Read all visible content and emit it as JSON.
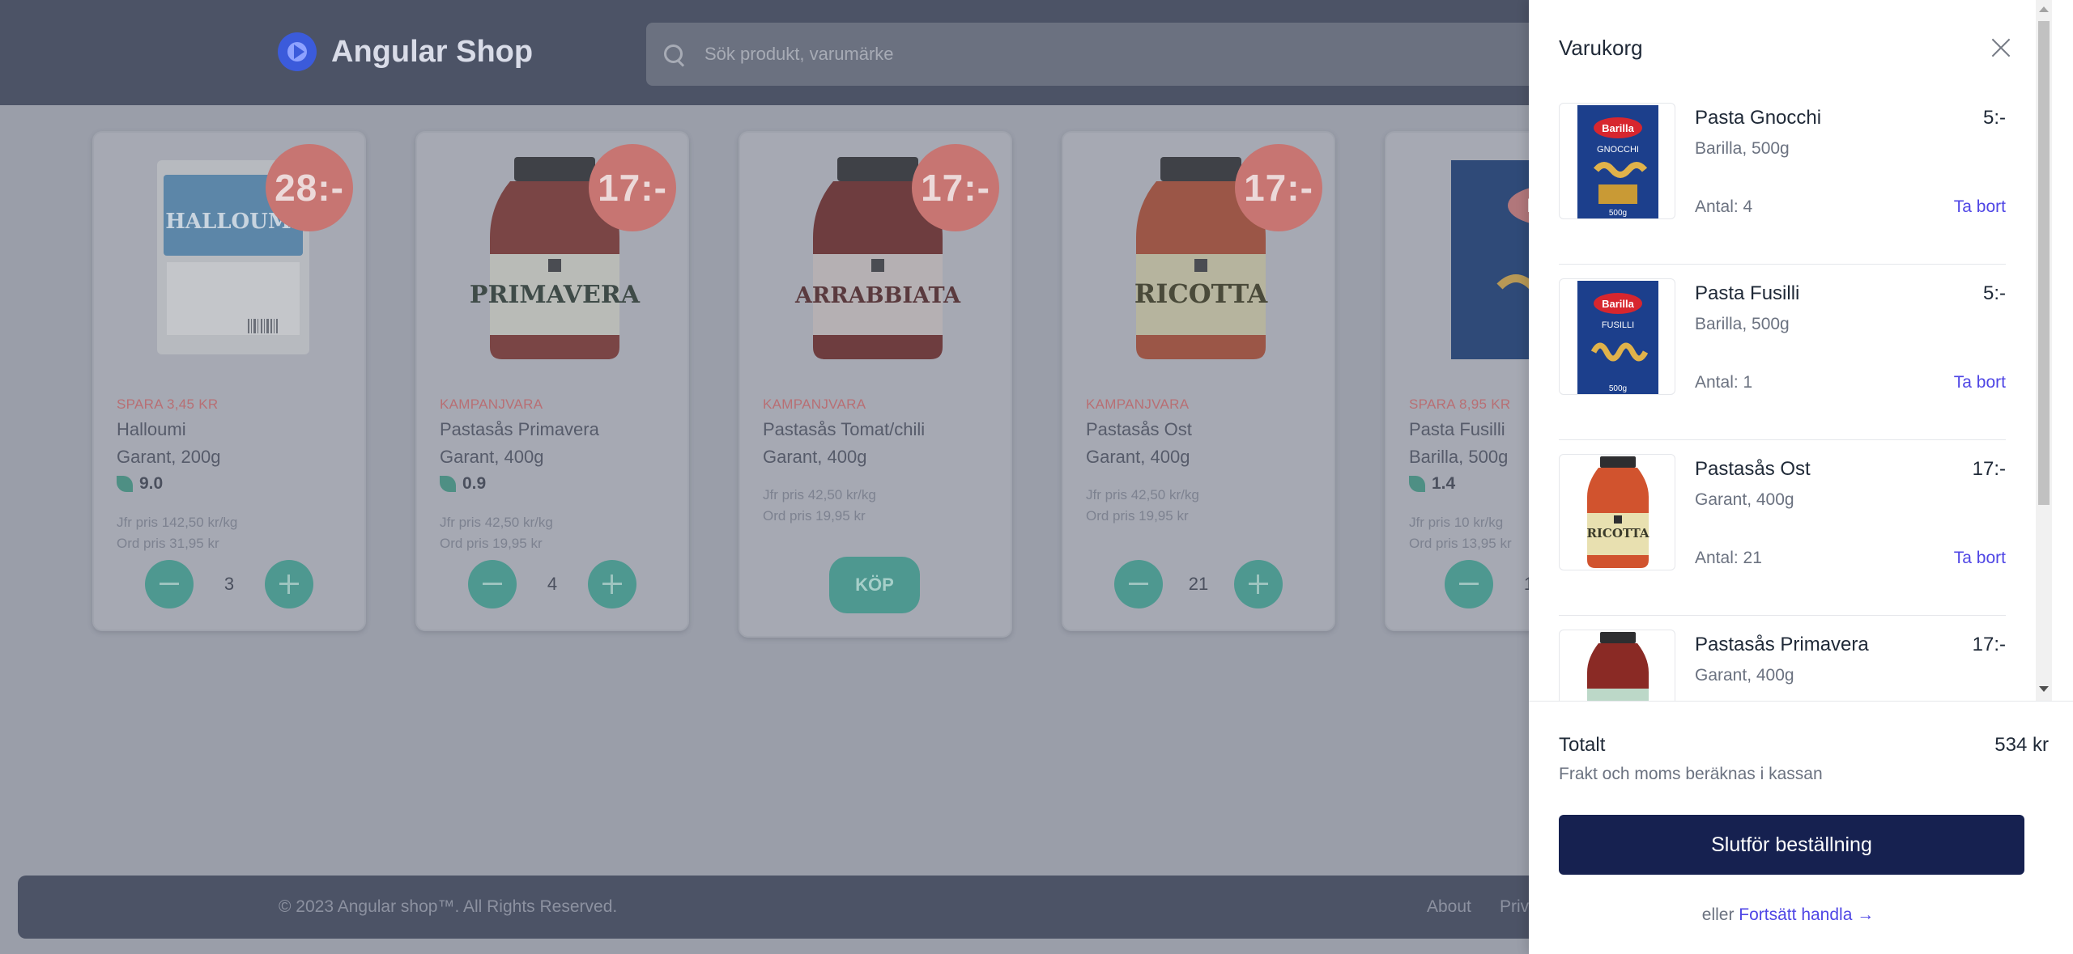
{
  "header": {
    "logo_text": "Angular Shop",
    "search_placeholder": "Sök produkt, varumärke"
  },
  "products": [
    {
      "price": "28:-",
      "tag": "SPARA 3,45 KR",
      "name": "Halloumi",
      "brand": "Garant, 200g",
      "eco": "9.0",
      "cmp1": "Jfr pris 142,50 kr/kg",
      "cmp2": "Ord pris 31,95 kr",
      "qty": "3",
      "image": "halloumi-package"
    },
    {
      "price": "17:-",
      "tag": "KAMPANJVARA",
      "name": "Pastasås Primavera",
      "brand": "Garant, 400g",
      "eco": "0.9",
      "cmp1": "Jfr pris 42,50 kr/kg",
      "cmp2": "Ord pris 19,95 kr",
      "qty": "4",
      "image": "primavera-jar"
    },
    {
      "price": "17:-",
      "tag": "KAMPANJVARA",
      "name": "Pastasås Tomat/chili",
      "brand": "Garant, 400g",
      "cmp1": "Jfr pris 42,50 kr/kg",
      "cmp2": "Ord pris 19,95 kr",
      "buy_label": "KÖP",
      "image": "arrabbiata-jar"
    },
    {
      "price": "17:-",
      "tag": "KAMPANJVARA",
      "name": "Pastasås Ost",
      "brand": "Garant, 400g",
      "cmp1": "Jfr pris 42,50 kr/kg",
      "cmp2": "Ord pris 19,95 kr",
      "qty": "21",
      "image": "ricotta-jar"
    },
    {
      "tag": "SPARA 8,95 KR",
      "name": "Pasta Fusilli",
      "brand": "Barilla, 500g",
      "eco": "1.4",
      "cmp1": "Jfr pris 10 kr/kg",
      "cmp2": "Ord pris 13,95 kr",
      "qty": "1",
      "image": "fusilli-box"
    }
  ],
  "footer": {
    "copyright": "© 2023 Angular shop™. All Rights Reserved.",
    "links": [
      "About",
      "Priv"
    ]
  },
  "cart": {
    "title": "Varukorg",
    "items": [
      {
        "name": "Pasta Gnocchi",
        "price": "5:-",
        "brand": "Barilla, 500g",
        "qty": "Antal: 4",
        "remove": "Ta bort",
        "image": "gnocchi-box",
        "image_label": "GNOCCHI",
        "image_brand": "Barilla",
        "image_weight": "500g"
      },
      {
        "name": "Pasta Fusilli",
        "price": "5:-",
        "brand": "Barilla, 500g",
        "qty": "Antal: 1",
        "remove": "Ta bort",
        "image": "fusilli-box",
        "image_label": "FUSILLI",
        "image_brand": "Barilla",
        "image_weight": "500g"
      },
      {
        "name": "Pastasås Ost",
        "price": "17:-",
        "brand": "Garant, 400g",
        "qty": "Antal: 21",
        "remove": "Ta bort",
        "image": "ricotta-jar",
        "image_label": "RICOTTA"
      },
      {
        "name": "Pastasås Primavera",
        "price": "17:-",
        "brand": "Garant, 400g",
        "image": "primavera-jar"
      }
    ],
    "total_label": "Totalt",
    "total_value": "534 kr",
    "total_note": "Frakt och moms beräknas i kassan",
    "checkout_label": "Slutför beställning",
    "continue_prefix": "eller",
    "continue_link": "Fortsätt handla →"
  }
}
